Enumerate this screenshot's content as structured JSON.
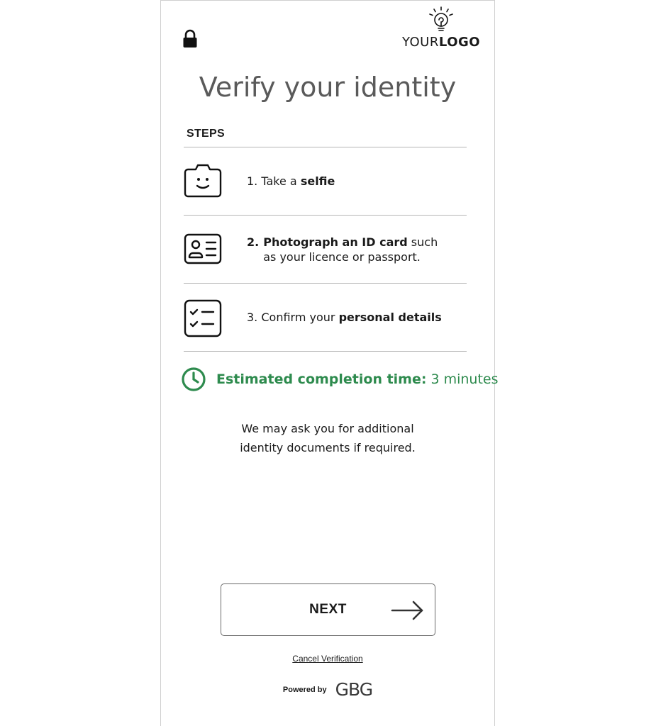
{
  "header": {
    "lock_icon": "lock-icon",
    "logo": {
      "prefix": "YOUR",
      "bold": "LOGO",
      "icon": "lightbulb-icon"
    }
  },
  "title": "Verify your identity",
  "steps": {
    "heading": "STEPS",
    "items": [
      {
        "number": "1.",
        "prefix": "Take a ",
        "bold": "selfie",
        "suffix": "",
        "icon": "camera-selfie-icon"
      },
      {
        "number": "2.",
        "bold": "Photograph an ID card",
        "suffix": " such as your licence or passport.",
        "icon": "id-card-icon"
      },
      {
        "number": "3.",
        "prefix": "Confirm your ",
        "bold": "personal details",
        "suffix": "",
        "icon": "checklist-icon"
      }
    ]
  },
  "estimate": {
    "label": "Estimated completion time:",
    "value": "3 minutes",
    "icon": "clock-icon",
    "color": "#2e8b4e"
  },
  "note": {
    "line1": "We may ask you for additional",
    "line2": "identity documents if required."
  },
  "next_button": {
    "label": "NEXT",
    "icon": "arrow-right-icon"
  },
  "cancel_link": "Cancel Verification",
  "footer": {
    "powered_by": "Powered by",
    "brand": "GBG"
  }
}
